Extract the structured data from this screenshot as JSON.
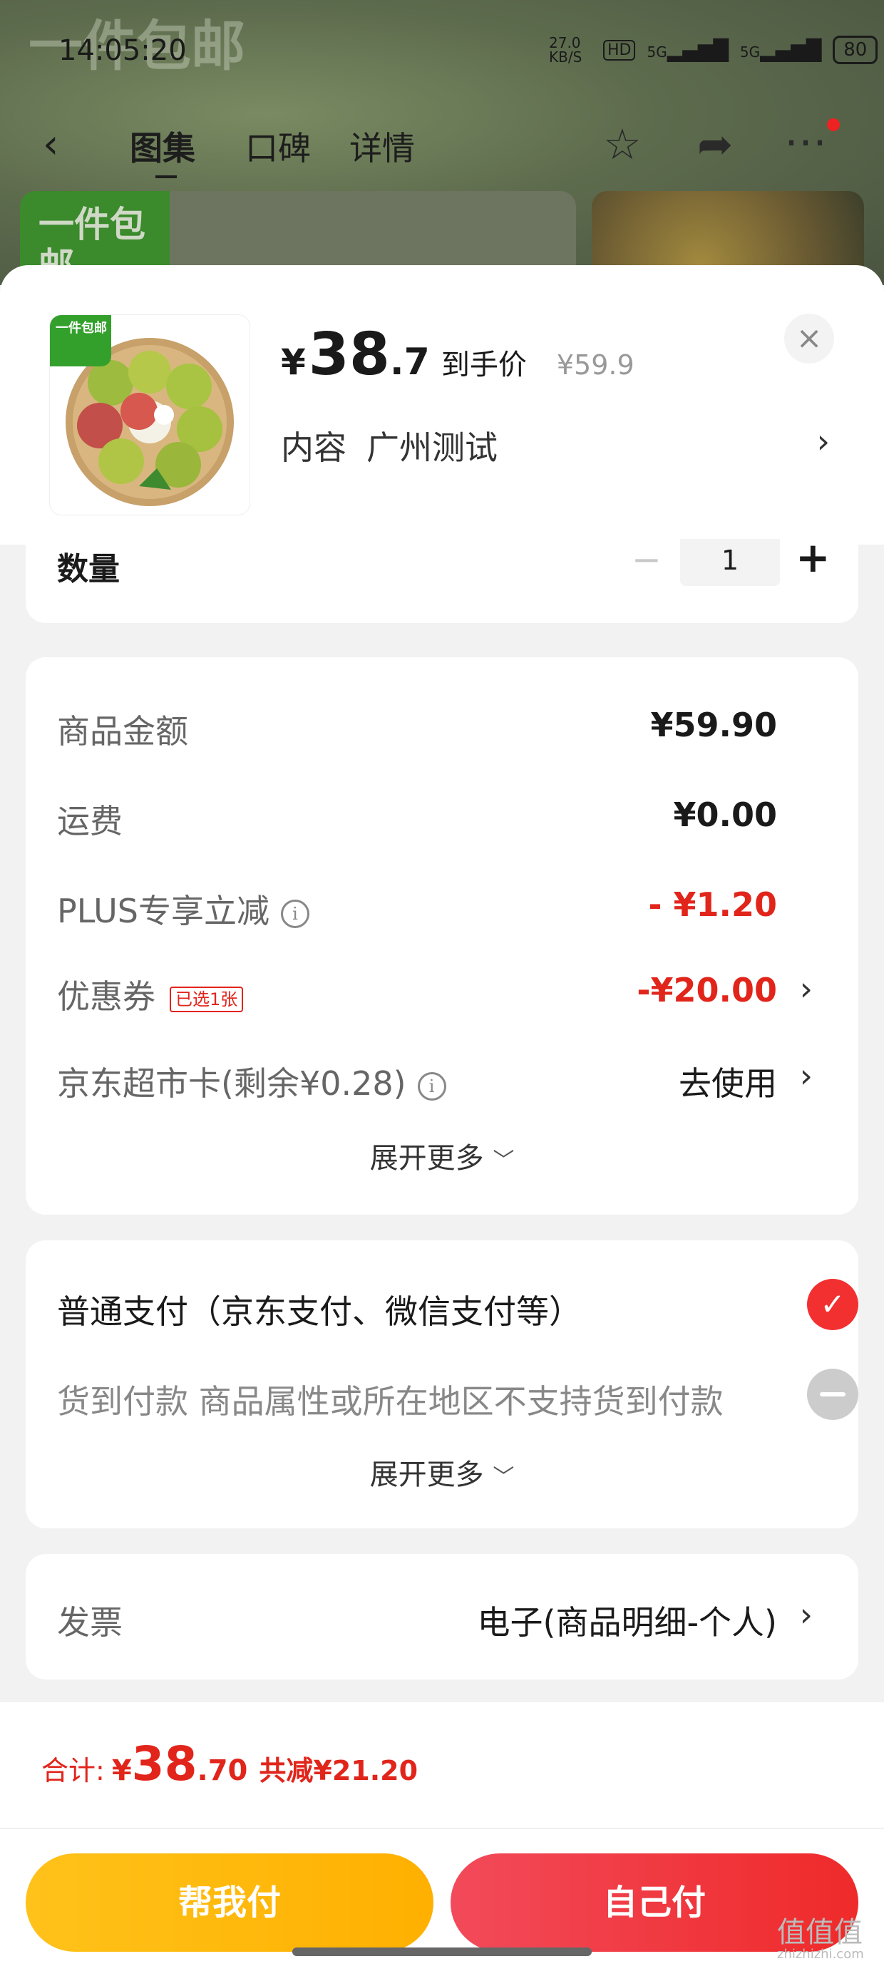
{
  "status_bar": {
    "time": "14:05:20",
    "net_speed": "27.0 KB/S",
    "hd": "HD",
    "signal1": "5G",
    "signal2": "5G",
    "battery": "80"
  },
  "nav": {
    "tabs": [
      "图集",
      "口碑",
      "详情"
    ]
  },
  "background": {
    "banner_text": "一件包邮"
  },
  "product": {
    "thumb_tag": "一件包邮",
    "price_currency": "¥",
    "price_int": "38",
    "price_dec": ".7",
    "price_tag": "到手价",
    "original_price": "¥59.9",
    "variant_label": "内容",
    "variant_value": "广州测试"
  },
  "quantity": {
    "label": "数量",
    "value": "1",
    "minus": "−",
    "plus": "+"
  },
  "costs": {
    "goods_label": "商品金额",
    "goods_value": "¥59.90",
    "shipping_label": "运费",
    "shipping_value": "¥0.00",
    "plus_label": "PLUS专享立减",
    "plus_value": "- ¥1.20",
    "coupon_label": "优惠券",
    "coupon_badge": "已选1张",
    "coupon_value": "-¥20.00",
    "card_label": "京东超市卡(剩余¥0.28)",
    "card_value": "去使用",
    "expand": "展开更多"
  },
  "payment": {
    "normal": "普通支付（京东支付、微信支付等）",
    "cod": "货到付款 商品属性或所在地区不支持货到付款",
    "expand": "展开更多"
  },
  "invoice": {
    "label": "发票",
    "value": "电子(商品明细-个人)"
  },
  "footer": {
    "total_label": "合计:",
    "total_currency": "¥",
    "total_int": "38",
    "total_dec": ".70",
    "saved": "共减¥21.20",
    "btn_friend": "帮我付",
    "btn_self": "自己付"
  },
  "watermark": {
    "text": "值值值",
    "site": "zhizhizhi.com"
  },
  "colors": {
    "accent_red": "#e1251b",
    "button_yellow": "#ffb000",
    "button_red": "#ef2a2a"
  }
}
